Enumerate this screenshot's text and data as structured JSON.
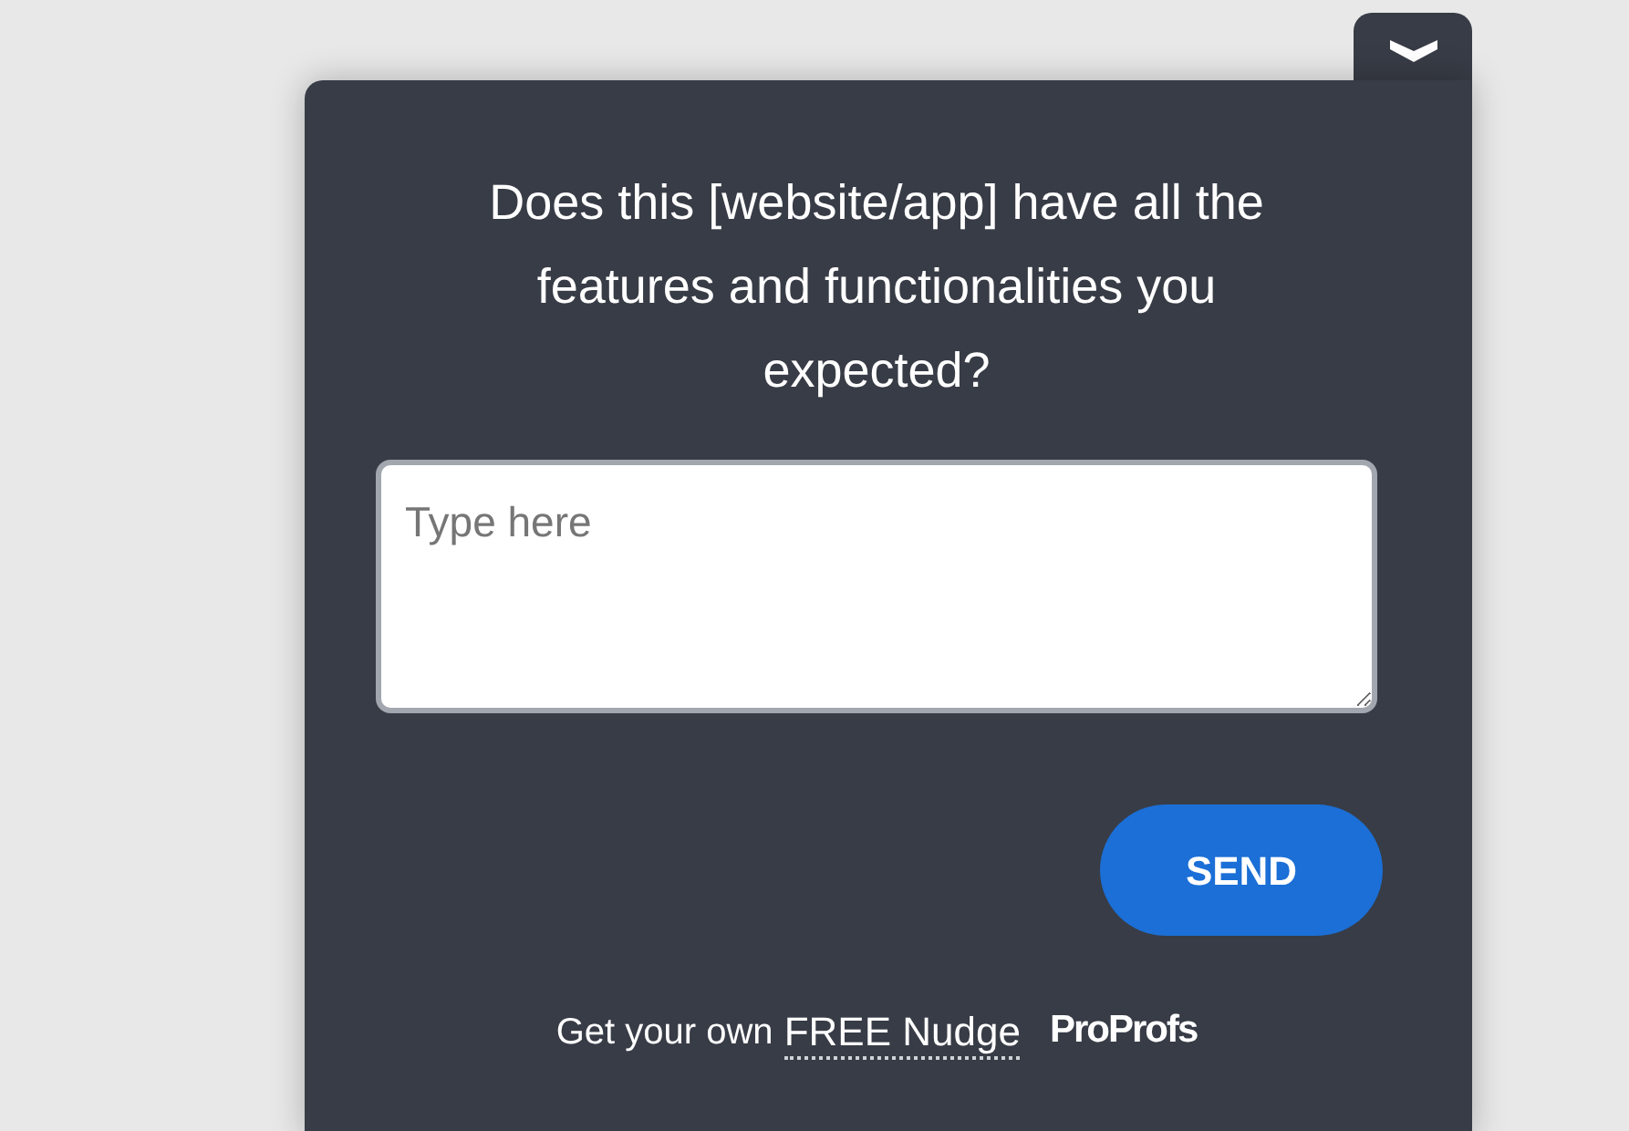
{
  "question": "Does this [website/app] have all the features and functionalities you expected?",
  "answer_field": {
    "placeholder": "Type here"
  },
  "send_button": "SEND",
  "footer": {
    "text": "Get your own",
    "link": "FREE Nudge",
    "brand": "ProProfs"
  }
}
